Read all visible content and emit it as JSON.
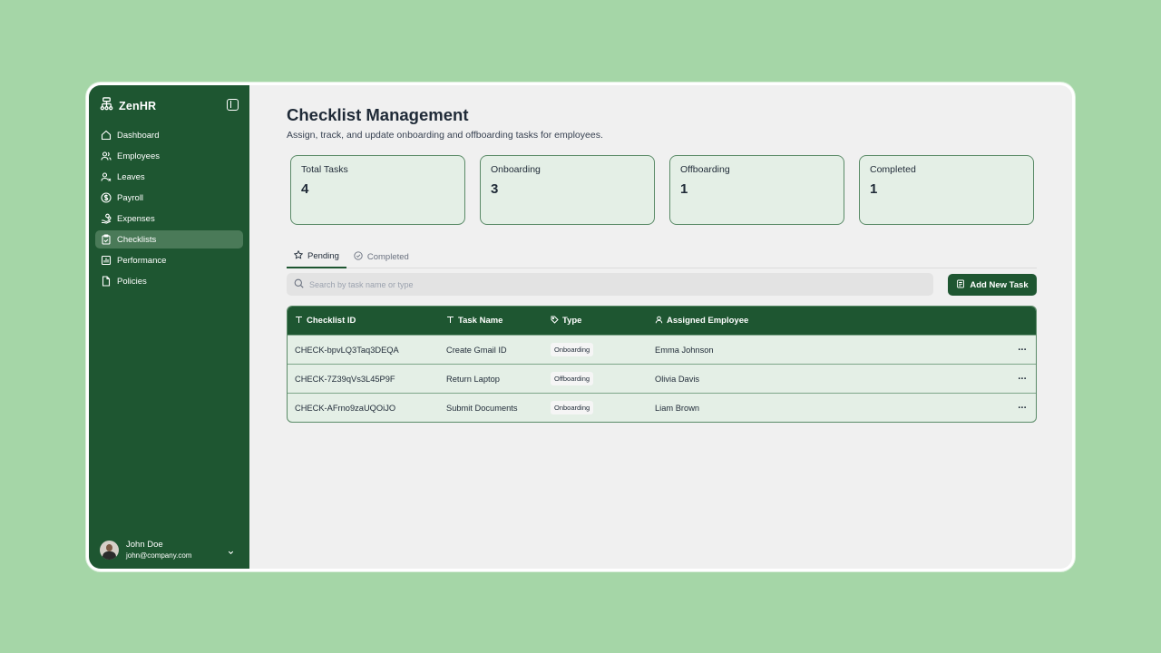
{
  "app": {
    "brand": "ZenHR"
  },
  "sidebar": {
    "items": [
      {
        "label": "Dashboard",
        "icon": "home-icon"
      },
      {
        "label": "Employees",
        "icon": "users-icon"
      },
      {
        "label": "Leaves",
        "icon": "user-x-icon"
      },
      {
        "label": "Payroll",
        "icon": "dollar-circle-icon"
      },
      {
        "label": "Expenses",
        "icon": "hand-coins-icon"
      },
      {
        "label": "Checklists",
        "icon": "clipboard-check-icon",
        "active": true
      },
      {
        "label": "Performance",
        "icon": "bar-chart-icon"
      },
      {
        "label": "Policies",
        "icon": "file-icon"
      }
    ]
  },
  "user": {
    "name": "John Doe",
    "email": "john@company.com"
  },
  "page": {
    "title": "Checklist Management",
    "subtitle": "Assign, track, and update onboarding and offboarding tasks for employees."
  },
  "stats": [
    {
      "label": "Total Tasks",
      "value": "4"
    },
    {
      "label": "Onboarding",
      "value": "3"
    },
    {
      "label": "Offboarding",
      "value": "1"
    },
    {
      "label": "Completed",
      "value": "1"
    }
  ],
  "tabs": [
    {
      "label": "Pending",
      "active": true
    },
    {
      "label": "Completed",
      "active": false
    }
  ],
  "search": {
    "placeholder": "Search by task name or type"
  },
  "add_button": {
    "label": "Add New Task"
  },
  "table": {
    "headers": [
      "Checklist ID",
      "Task Name",
      "Type",
      "Assigned Employee"
    ],
    "rows": [
      {
        "id": "CHECK-bpvLQ3Taq3DEQA",
        "task": "Create Gmail ID",
        "type": "Onboarding",
        "employee": "Emma Johnson"
      },
      {
        "id": "CHECK-7Z39qVs3L45P9F",
        "task": "Return Laptop",
        "type": "Offboarding",
        "employee": "Olivia Davis"
      },
      {
        "id": "CHECK-AFrno9zaUQOiJO",
        "task": "Submit Documents",
        "type": "Onboarding",
        "employee": "Liam Brown"
      }
    ]
  },
  "colors": {
    "primary": "#1e5631",
    "background": "#a5d6a7",
    "card": "#e4efe6"
  }
}
